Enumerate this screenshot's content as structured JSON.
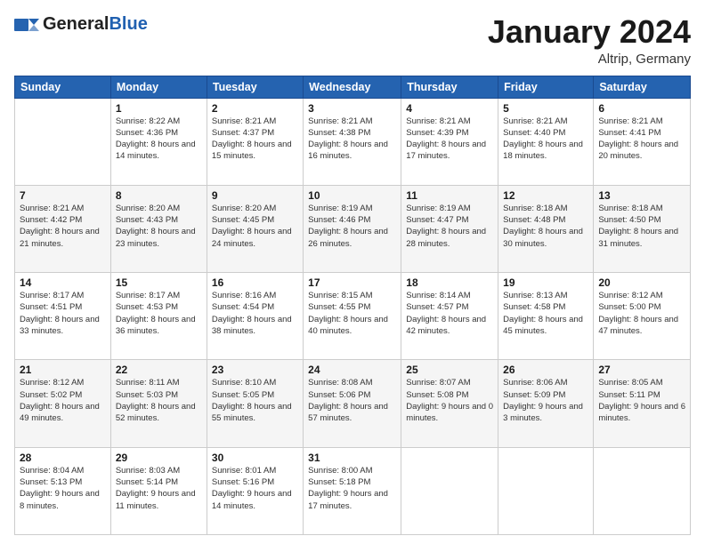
{
  "header": {
    "logo_general": "General",
    "logo_blue": "Blue",
    "month": "January 2024",
    "location": "Altrip, Germany"
  },
  "weekdays": [
    "Sunday",
    "Monday",
    "Tuesday",
    "Wednesday",
    "Thursday",
    "Friday",
    "Saturday"
  ],
  "weeks": [
    [
      {
        "day": "",
        "sunrise": "",
        "sunset": "",
        "daylight": ""
      },
      {
        "day": "1",
        "sunrise": "Sunrise: 8:22 AM",
        "sunset": "Sunset: 4:36 PM",
        "daylight": "Daylight: 8 hours and 14 minutes."
      },
      {
        "day": "2",
        "sunrise": "Sunrise: 8:21 AM",
        "sunset": "Sunset: 4:37 PM",
        "daylight": "Daylight: 8 hours and 15 minutes."
      },
      {
        "day": "3",
        "sunrise": "Sunrise: 8:21 AM",
        "sunset": "Sunset: 4:38 PM",
        "daylight": "Daylight: 8 hours and 16 minutes."
      },
      {
        "day": "4",
        "sunrise": "Sunrise: 8:21 AM",
        "sunset": "Sunset: 4:39 PM",
        "daylight": "Daylight: 8 hours and 17 minutes."
      },
      {
        "day": "5",
        "sunrise": "Sunrise: 8:21 AM",
        "sunset": "Sunset: 4:40 PM",
        "daylight": "Daylight: 8 hours and 18 minutes."
      },
      {
        "day": "6",
        "sunrise": "Sunrise: 8:21 AM",
        "sunset": "Sunset: 4:41 PM",
        "daylight": "Daylight: 8 hours and 20 minutes."
      }
    ],
    [
      {
        "day": "7",
        "sunrise": "Sunrise: 8:21 AM",
        "sunset": "Sunset: 4:42 PM",
        "daylight": "Daylight: 8 hours and 21 minutes."
      },
      {
        "day": "8",
        "sunrise": "Sunrise: 8:20 AM",
        "sunset": "Sunset: 4:43 PM",
        "daylight": "Daylight: 8 hours and 23 minutes."
      },
      {
        "day": "9",
        "sunrise": "Sunrise: 8:20 AM",
        "sunset": "Sunset: 4:45 PM",
        "daylight": "Daylight: 8 hours and 24 minutes."
      },
      {
        "day": "10",
        "sunrise": "Sunrise: 8:19 AM",
        "sunset": "Sunset: 4:46 PM",
        "daylight": "Daylight: 8 hours and 26 minutes."
      },
      {
        "day": "11",
        "sunrise": "Sunrise: 8:19 AM",
        "sunset": "Sunset: 4:47 PM",
        "daylight": "Daylight: 8 hours and 28 minutes."
      },
      {
        "day": "12",
        "sunrise": "Sunrise: 8:18 AM",
        "sunset": "Sunset: 4:48 PM",
        "daylight": "Daylight: 8 hours and 30 minutes."
      },
      {
        "day": "13",
        "sunrise": "Sunrise: 8:18 AM",
        "sunset": "Sunset: 4:50 PM",
        "daylight": "Daylight: 8 hours and 31 minutes."
      }
    ],
    [
      {
        "day": "14",
        "sunrise": "Sunrise: 8:17 AM",
        "sunset": "Sunset: 4:51 PM",
        "daylight": "Daylight: 8 hours and 33 minutes."
      },
      {
        "day": "15",
        "sunrise": "Sunrise: 8:17 AM",
        "sunset": "Sunset: 4:53 PM",
        "daylight": "Daylight: 8 hours and 36 minutes."
      },
      {
        "day": "16",
        "sunrise": "Sunrise: 8:16 AM",
        "sunset": "Sunset: 4:54 PM",
        "daylight": "Daylight: 8 hours and 38 minutes."
      },
      {
        "day": "17",
        "sunrise": "Sunrise: 8:15 AM",
        "sunset": "Sunset: 4:55 PM",
        "daylight": "Daylight: 8 hours and 40 minutes."
      },
      {
        "day": "18",
        "sunrise": "Sunrise: 8:14 AM",
        "sunset": "Sunset: 4:57 PM",
        "daylight": "Daylight: 8 hours and 42 minutes."
      },
      {
        "day": "19",
        "sunrise": "Sunrise: 8:13 AM",
        "sunset": "Sunset: 4:58 PM",
        "daylight": "Daylight: 8 hours and 45 minutes."
      },
      {
        "day": "20",
        "sunrise": "Sunrise: 8:12 AM",
        "sunset": "Sunset: 5:00 PM",
        "daylight": "Daylight: 8 hours and 47 minutes."
      }
    ],
    [
      {
        "day": "21",
        "sunrise": "Sunrise: 8:12 AM",
        "sunset": "Sunset: 5:02 PM",
        "daylight": "Daylight: 8 hours and 49 minutes."
      },
      {
        "day": "22",
        "sunrise": "Sunrise: 8:11 AM",
        "sunset": "Sunset: 5:03 PM",
        "daylight": "Daylight: 8 hours and 52 minutes."
      },
      {
        "day": "23",
        "sunrise": "Sunrise: 8:10 AM",
        "sunset": "Sunset: 5:05 PM",
        "daylight": "Daylight: 8 hours and 55 minutes."
      },
      {
        "day": "24",
        "sunrise": "Sunrise: 8:08 AM",
        "sunset": "Sunset: 5:06 PM",
        "daylight": "Daylight: 8 hours and 57 minutes."
      },
      {
        "day": "25",
        "sunrise": "Sunrise: 8:07 AM",
        "sunset": "Sunset: 5:08 PM",
        "daylight": "Daylight: 9 hours and 0 minutes."
      },
      {
        "day": "26",
        "sunrise": "Sunrise: 8:06 AM",
        "sunset": "Sunset: 5:09 PM",
        "daylight": "Daylight: 9 hours and 3 minutes."
      },
      {
        "day": "27",
        "sunrise": "Sunrise: 8:05 AM",
        "sunset": "Sunset: 5:11 PM",
        "daylight": "Daylight: 9 hours and 6 minutes."
      }
    ],
    [
      {
        "day": "28",
        "sunrise": "Sunrise: 8:04 AM",
        "sunset": "Sunset: 5:13 PM",
        "daylight": "Daylight: 9 hours and 8 minutes."
      },
      {
        "day": "29",
        "sunrise": "Sunrise: 8:03 AM",
        "sunset": "Sunset: 5:14 PM",
        "daylight": "Daylight: 9 hours and 11 minutes."
      },
      {
        "day": "30",
        "sunrise": "Sunrise: 8:01 AM",
        "sunset": "Sunset: 5:16 PM",
        "daylight": "Daylight: 9 hours and 14 minutes."
      },
      {
        "day": "31",
        "sunrise": "Sunrise: 8:00 AM",
        "sunset": "Sunset: 5:18 PM",
        "daylight": "Daylight: 9 hours and 17 minutes."
      },
      {
        "day": "",
        "sunrise": "",
        "sunset": "",
        "daylight": ""
      },
      {
        "day": "",
        "sunrise": "",
        "sunset": "",
        "daylight": ""
      },
      {
        "day": "",
        "sunrise": "",
        "sunset": "",
        "daylight": ""
      }
    ]
  ]
}
